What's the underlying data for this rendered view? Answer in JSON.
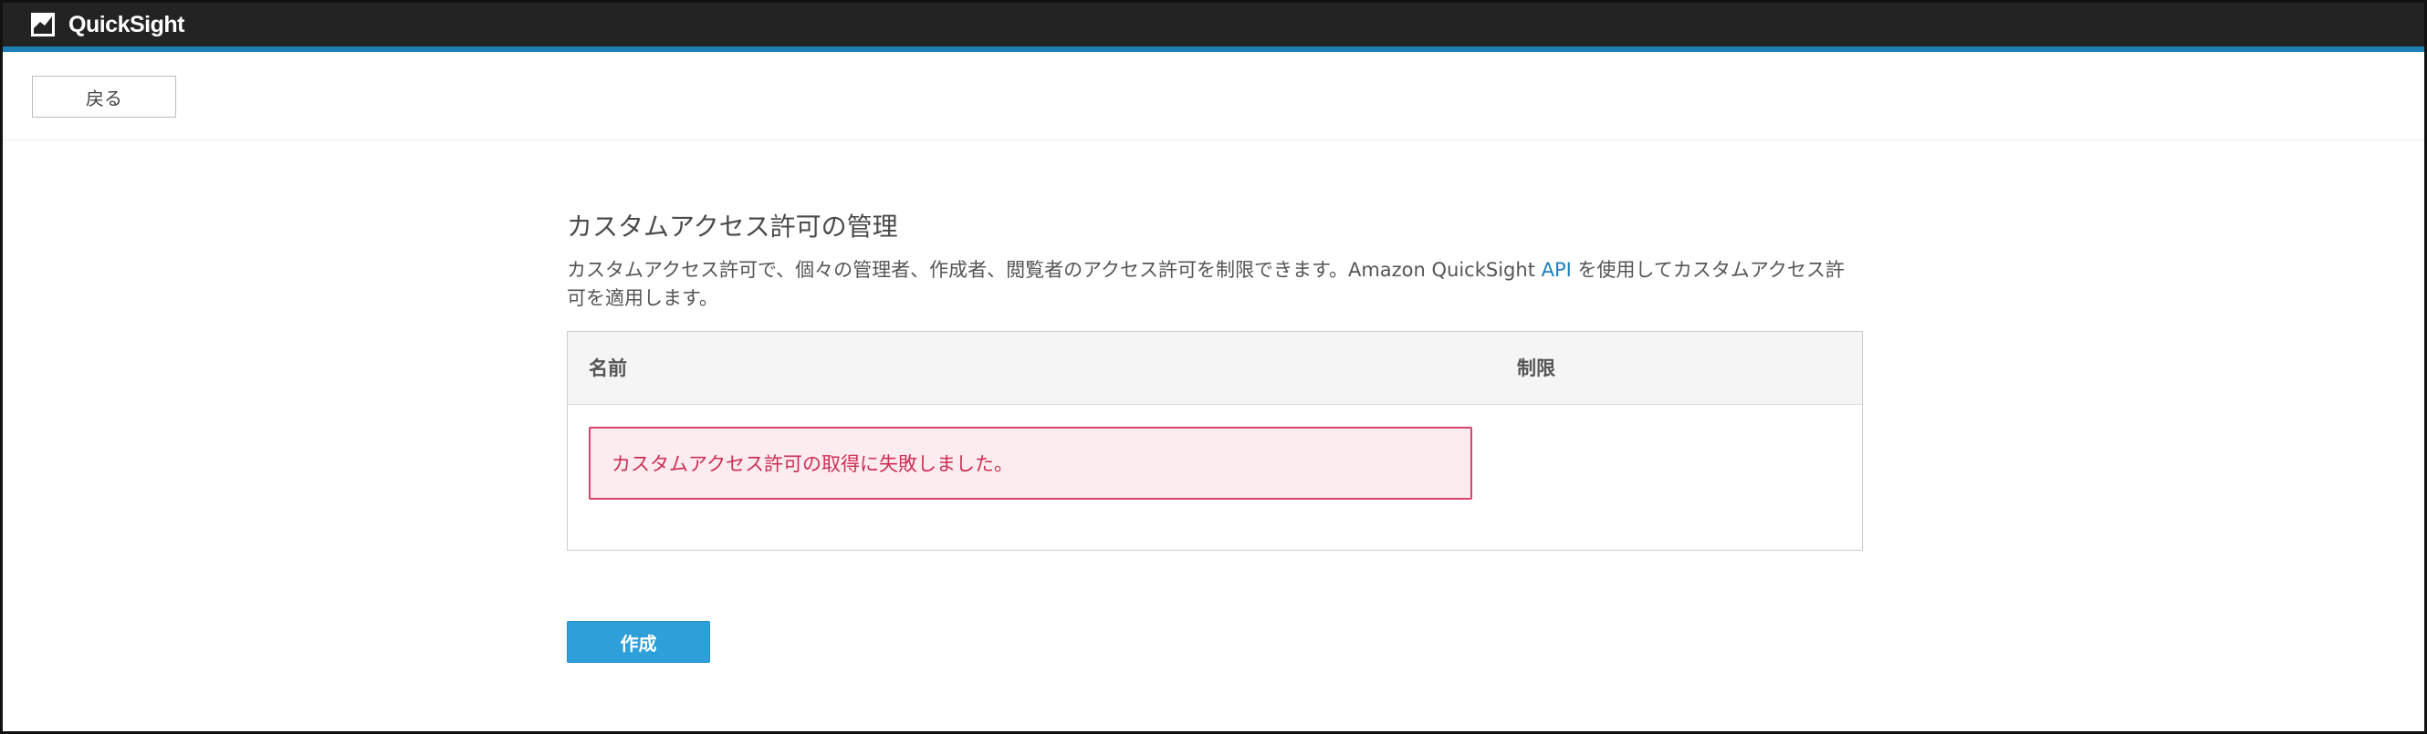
{
  "app": {
    "name": "QuickSight",
    "logo_icon": "quicksight-logo-icon",
    "accent_color": "#1d7fb3"
  },
  "nav": {
    "back_label": "戻る"
  },
  "main": {
    "title": "カスタムアクセス許可の管理",
    "description_before_link": "カスタムアクセス許可で、個々の管理者、作成者、閲覧者のアクセス許可を制限できます。Amazon QuickSight ",
    "description_link": "API",
    "description_after_link": " を使用してカスタムアクセス許可を適用します。",
    "table": {
      "columns": [
        "名前",
        "制限"
      ],
      "error_message": "カスタムアクセス許可の取得に失敗しました。"
    },
    "create_label": "作成"
  }
}
